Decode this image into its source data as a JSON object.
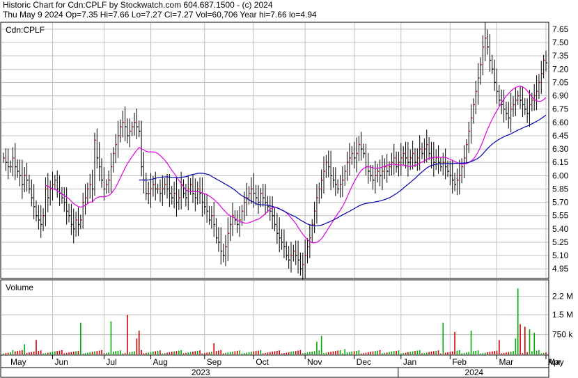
{
  "header": {
    "line1": "Historic Chart for Cdn:CPLF by Stockwatch.com 604.687.1500 - (c) 2024",
    "line2": "Thu May  9 2024  Op=7.35  Hi=7.66  Lo=7.27  Cl=7.27  Vol=60,706  Year hi=7.66  lo=4.94"
  },
  "chart_data": [
    {
      "type": "bar",
      "style": "ohlc",
      "symbol_label": "Cdn:CPLF",
      "ylim": [
        4.85,
        7.72
      ],
      "yticks": [
        "7.65",
        "7.50",
        "7.35",
        "7.20",
        "7.05",
        "6.90",
        "6.75",
        "6.60",
        "6.45",
        "6.30",
        "6.15",
        "6.00",
        "5.85",
        "5.70",
        "5.55",
        "5.40",
        "5.25",
        "5.10",
        "4.95"
      ],
      "x_months": [
        "May",
        "Jun",
        "Jul",
        "Aug",
        "Sep",
        "Oct",
        "Nov",
        "Dec",
        "Jan",
        "Feb",
        "Mar",
        "Apr",
        "May"
      ],
      "x_years": [
        "2023",
        "2024"
      ],
      "grid": true,
      "colors": {
        "up": "#cc0000",
        "down": "#000000",
        "ma_short": "#e000e0",
        "ma_long": "#0000aa",
        "grid": "#c0c0c0"
      },
      "series": [
        {
          "kind": "daily_close",
          "values": [
            6.2,
            6.15,
            6.1,
            6.1,
            6.2,
            6.1,
            6.05,
            6.0,
            5.9,
            6.0,
            5.95,
            5.85,
            5.75,
            5.65,
            5.55,
            5.5,
            5.45,
            5.55,
            5.85,
            5.75,
            5.85,
            5.9,
            5.95,
            5.85,
            5.8,
            5.75,
            5.7,
            5.6,
            5.55,
            5.45,
            5.4,
            5.5,
            5.45,
            5.5,
            5.7,
            5.75,
            5.85,
            5.9,
            5.85,
            6.4,
            6.2,
            6.1,
            5.95,
            5.85,
            5.9,
            5.95,
            6.1,
            6.25,
            6.35,
            6.45,
            6.55,
            6.6,
            6.55,
            6.45,
            6.5,
            6.55,
            6.6,
            6.55,
            6.5,
            6.1,
            5.95,
            5.8,
            5.8,
            5.85,
            5.9,
            5.85,
            5.85,
            5.8,
            5.85,
            5.9,
            5.85,
            5.8,
            5.75,
            5.8,
            5.7,
            5.75,
            5.9,
            5.8,
            5.75,
            5.85,
            5.9,
            5.8,
            5.75,
            5.85,
            5.8,
            5.7,
            5.65,
            5.6,
            5.5,
            5.55,
            5.45,
            5.3,
            5.25,
            5.15,
            5.1,
            5.2,
            5.35,
            5.45,
            5.55,
            5.5,
            5.45,
            5.5,
            5.6,
            5.7,
            5.75,
            5.8,
            5.85,
            5.8,
            5.75,
            5.7,
            5.8,
            5.75,
            5.7,
            5.65,
            5.6,
            5.55,
            5.45,
            5.35,
            5.3,
            5.25,
            5.2,
            5.1,
            5.05,
            5.1,
            5.15,
            5.1,
            5.05,
            4.95,
            5.0,
            5.1,
            5.2,
            5.3,
            5.45,
            5.6,
            5.75,
            5.85,
            5.95,
            6.05,
            6.15,
            6.1,
            6.0,
            5.95,
            5.9,
            5.85,
            5.9,
            5.95,
            6.05,
            6.15,
            6.2,
            6.25,
            6.2,
            6.25,
            6.35,
            6.3,
            6.25,
            6.1,
            6.05,
            6.0,
            5.95,
            6.0,
            6.05,
            6.0,
            6.05,
            6.1,
            6.05,
            6.1,
            6.15,
            6.2,
            6.1,
            6.15,
            6.2,
            6.25,
            6.2,
            6.15,
            6.2,
            6.25,
            6.15,
            6.2,
            6.3,
            6.25,
            6.3,
            6.35,
            6.25,
            6.2,
            6.15,
            6.2,
            6.15,
            6.1,
            6.15,
            6.1,
            6.05,
            6.0,
            5.95,
            5.9,
            5.95,
            6.0,
            6.1,
            6.2,
            6.35,
            6.5,
            6.65,
            6.8,
            6.95,
            7.1,
            7.25,
            7.45,
            7.55,
            7.45,
            7.3,
            7.2,
            7.05,
            6.95,
            6.85,
            6.8,
            6.75,
            6.7,
            6.65,
            6.75,
            6.8,
            6.85,
            6.9,
            6.85,
            6.8,
            6.75,
            6.7,
            6.8,
            6.85,
            6.9,
            6.95,
            7.05,
            7.15,
            7.3,
            7.27
          ]
        },
        {
          "kind": "moving_average",
          "name": "",
          "color": "#e000e0"
        },
        {
          "kind": "moving_average",
          "name": "",
          "color": "#0000aa"
        }
      ]
    },
    {
      "type": "bar",
      "title": "Volume",
      "yticks": [
        "2.2 M",
        "1.5 M",
        "750 k"
      ],
      "ylim": [
        0,
        2800000
      ],
      "colors": {
        "up": "#00aa00",
        "down": "#cc0000"
      },
      "spikes": [
        {
          "i": 4,
          "v": 160000
        },
        {
          "i": 9,
          "v": 380000
        },
        {
          "i": 14,
          "v": 550000
        },
        {
          "i": 33,
          "v": 1200000
        },
        {
          "i": 46,
          "v": 1250000
        },
        {
          "i": 53,
          "v": 1500000
        },
        {
          "i": 57,
          "v": 600000
        },
        {
          "i": 58,
          "v": 900000
        },
        {
          "i": 90,
          "v": 420000
        },
        {
          "i": 134,
          "v": 480000
        },
        {
          "i": 136,
          "v": 700000
        },
        {
          "i": 146,
          "v": 200000
        },
        {
          "i": 188,
          "v": 1200000
        },
        {
          "i": 193,
          "v": 850000
        },
        {
          "i": 200,
          "v": 900000
        },
        {
          "i": 212,
          "v": 540000
        },
        {
          "i": 219,
          "v": 600000
        },
        {
          "i": 220,
          "v": 2500000
        },
        {
          "i": 221,
          "v": 1150000
        },
        {
          "i": 223,
          "v": 1050000
        },
        {
          "i": 225,
          "v": 950000
        },
        {
          "i": 227,
          "v": 820000
        },
        {
          "i": 244,
          "v": 450000
        }
      ],
      "base_volume": 80000
    }
  ]
}
